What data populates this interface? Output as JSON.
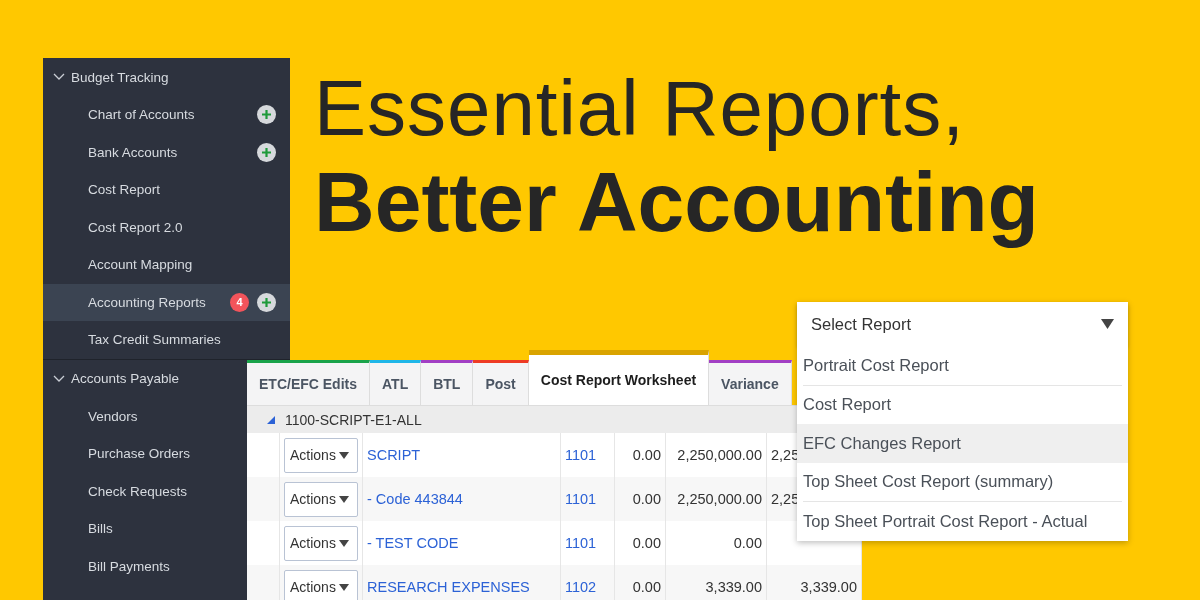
{
  "headline": {
    "line_1": "Essential Reports,",
    "line_2": "Better Accounting"
  },
  "sidebar": {
    "sections": [
      {
        "label": "Budget Tracking",
        "expanded": true,
        "items": [
          {
            "label": "Chart of Accounts",
            "selected": false,
            "add_button": true
          },
          {
            "label": "Bank Accounts",
            "selected": false,
            "add_button": true
          },
          {
            "label": "Cost Report",
            "selected": false,
            "add_button": false
          },
          {
            "label": "Cost Report 2.0",
            "selected": false,
            "add_button": false
          },
          {
            "label": "Account Mapping",
            "selected": false,
            "add_button": false
          },
          {
            "label": "Accounting Reports",
            "selected": true,
            "badge": "4",
            "add_button": true
          },
          {
            "label": "Tax Credit Summaries",
            "selected": false,
            "add_button": false
          }
        ]
      },
      {
        "label": "Accounts Payable",
        "expanded": true,
        "items": [
          {
            "label": "Vendors",
            "selected": false,
            "add_button": false
          },
          {
            "label": "Purchase Orders",
            "selected": false,
            "add_button": false
          },
          {
            "label": "Check Requests",
            "selected": false,
            "add_button": false
          },
          {
            "label": "Bills",
            "selected": false,
            "add_button": false
          },
          {
            "label": "Bill Payments",
            "selected": false,
            "add_button": false
          }
        ]
      }
    ]
  },
  "worksheet": {
    "tabs": [
      {
        "label": "ETC/EFC Edits",
        "selected": false,
        "color": "#1aa34a"
      },
      {
        "label": "ATL",
        "selected": false,
        "color": "#1fb6e8"
      },
      {
        "label": "BTL",
        "selected": false,
        "color": "#a23fc4"
      },
      {
        "label": "Post",
        "selected": false,
        "color": "#ee3b24"
      },
      {
        "label": "Cost Report Worksheet",
        "selected": true,
        "color": "#d9a300"
      },
      {
        "label": "Variance",
        "selected": false,
        "color": "#a23fc4"
      }
    ],
    "group": {
      "label": "1100-SCRIPT-E1-ALL",
      "expanded": true
    },
    "rows": [
      {
        "action": "Actions",
        "name": "SCRIPT",
        "code": "1101",
        "column_4": "0.00",
        "column_5": "2,250,000.00",
        "column_6": "2,25"
      },
      {
        "action": "Actions",
        "name": "- Code 443844",
        "code": "1101",
        "column_4": "0.00",
        "column_5": "2,250,000.00",
        "column_6": "2,25"
      },
      {
        "action": "Actions",
        "name": "- TEST CODE",
        "code": "1101",
        "column_4": "0.00",
        "column_5": "0.00"
      },
      {
        "action": "Actions",
        "name": "RESEARCH EXPENSES",
        "code": "1102",
        "column_4": "0.00",
        "column_5": "3,339.00",
        "column_6": "3,339.00"
      }
    ]
  },
  "report_select": {
    "value": "Select Report",
    "options": [
      {
        "label": "Portrait Cost Report",
        "highlighted": false
      },
      {
        "label": "Cost Report",
        "highlighted": false
      },
      {
        "label": "EFC Changes Report",
        "highlighted": true
      },
      {
        "label": "Top Sheet Cost Report (summary)",
        "highlighted": false
      },
      {
        "label": "Top Sheet Portrait Cost Report - Actual",
        "highlighted": false
      }
    ]
  }
}
